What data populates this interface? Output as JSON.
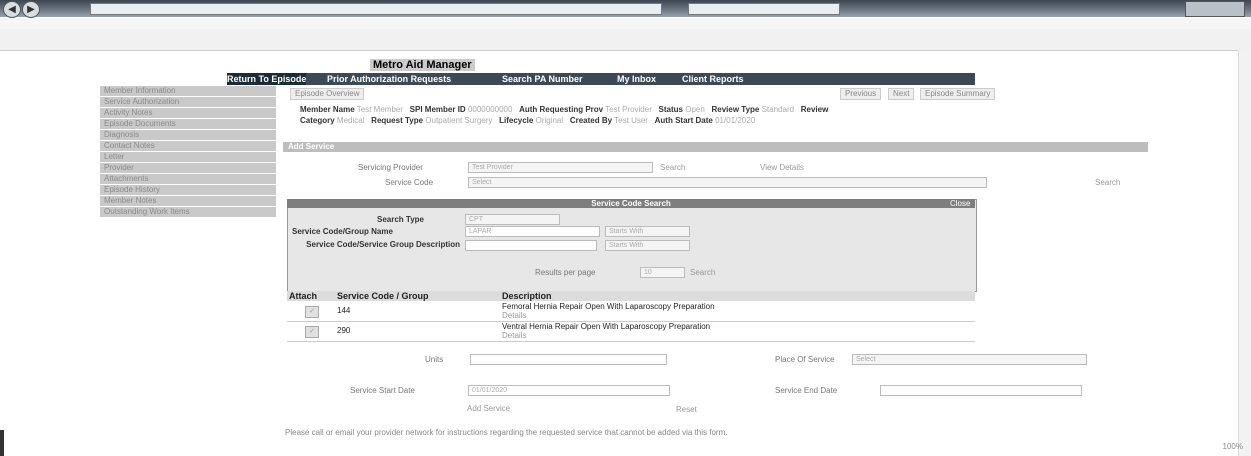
{
  "app_title": "Metro Aid Manager",
  "navbar": {
    "tabs": [
      {
        "label": "Return To Episode",
        "active": true
      },
      {
        "label": "Prior Authorization Requests",
        "active": false
      },
      {
        "label": "Search PA Number",
        "active": false
      },
      {
        "label": "My Inbox",
        "active": false
      },
      {
        "label": "Client Reports",
        "active": false
      }
    ]
  },
  "sidebar": {
    "items": [
      "Member Information",
      "Service Authorization",
      "Activity Notes",
      "Episode Documents",
      "Diagnosis",
      "Contact Notes",
      "Letter",
      "Provider",
      "Attachments",
      "Episode History",
      "Member Notes",
      "Outstanding Work Items"
    ]
  },
  "subnav": {
    "left": "Episode Overview",
    "right": [
      "Previous",
      "Next",
      "Episode Summary"
    ]
  },
  "info": {
    "line1": [
      {
        "k": "Member Name",
        "v": "Test Member"
      },
      {
        "k": "SPI Member ID",
        "v": "0000000000"
      },
      {
        "k": "Auth Requesting Prov",
        "v": "Test Provider"
      },
      {
        "k": "Status",
        "v": "Open"
      },
      {
        "k": "Review Type",
        "v": "Standard"
      },
      {
        "k": "Review",
        "v": ""
      }
    ],
    "line2": [
      {
        "k": "Category",
        "v": "Medical"
      },
      {
        "k": "Request Type",
        "v": "Outpatient Surgery"
      },
      {
        "k": "Lifecycle",
        "v": "Original"
      },
      {
        "k": "Created By",
        "v": "Test User"
      },
      {
        "k": "Auth Start Date",
        "v": "01/01/2020"
      }
    ]
  },
  "section_title": "Add Service",
  "form": {
    "servicing_provider_label": "Servicing Provider",
    "servicing_provider_value": "Test Provider",
    "search_label": "Search",
    "view_details_label": "View Details",
    "service_code_label": "Service Code",
    "service_code_value": "Select",
    "search_link": "Search"
  },
  "search_panel": {
    "title": "Service Code Search",
    "close": "Close",
    "search_type_label": "Search Type",
    "search_type_value": "CPT",
    "code_name_label": "Service Code/Group Name",
    "code_name_value": "LAPAR",
    "code_name_op": "Starts With",
    "desc_label": "Service Code/Service Group Description",
    "desc_op": "Starts With",
    "results_label": "Results per page",
    "results_value": "10",
    "search_btn": "Search"
  },
  "results": {
    "headers": [
      "Attach",
      "Service Code / Group",
      "Description"
    ],
    "rows": [
      {
        "code": "144",
        "desc": "Femoral Hernia Repair Open With Laparoscopy Preparation",
        "link": "Details"
      },
      {
        "code": "290",
        "desc": "Ventral Hernia Repair Open With Laparoscopy Preparation",
        "link": "Details"
      }
    ]
  },
  "lower_form": {
    "units_label": "Units",
    "place_of_service_label": "Place Of Service",
    "place_of_service_value": "Select",
    "start_date_label": "Service Start Date",
    "start_date_value": "01/01/2020",
    "end_date_label": "Service End Date",
    "add_button": "Add Service",
    "reset_button": "Reset"
  },
  "footnote": "Please call or email your provider network for instructions regarding the requested service that cannot be added via this form.",
  "zoom": "100%",
  "colors": {
    "navbar": "#3b4a55",
    "sidebar": "#c9c9c9",
    "section": "#bdbdbd"
  }
}
